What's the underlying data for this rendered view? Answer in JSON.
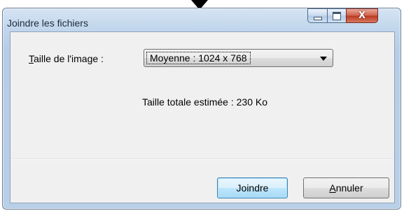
{
  "window": {
    "title": "Joindre les fichiers",
    "controls": {
      "close_glyph": "X"
    }
  },
  "form": {
    "size_label_accel": "T",
    "size_label_rest": "aille de l'image :",
    "size_select": {
      "selected": "Moyenne : 1024 x 768"
    },
    "estimate": "Taille totale estimée : 230 Ko"
  },
  "buttons": {
    "attach_label": "Joindre",
    "cancel_accel": "A",
    "cancel_rest": "nnuler"
  },
  "icons": {
    "top_arrow": "down-triangle-icon",
    "minimize": "minimize-icon",
    "maximize": "maximize-icon",
    "close": "close-icon",
    "dropdown": "chevron-down-icon"
  }
}
